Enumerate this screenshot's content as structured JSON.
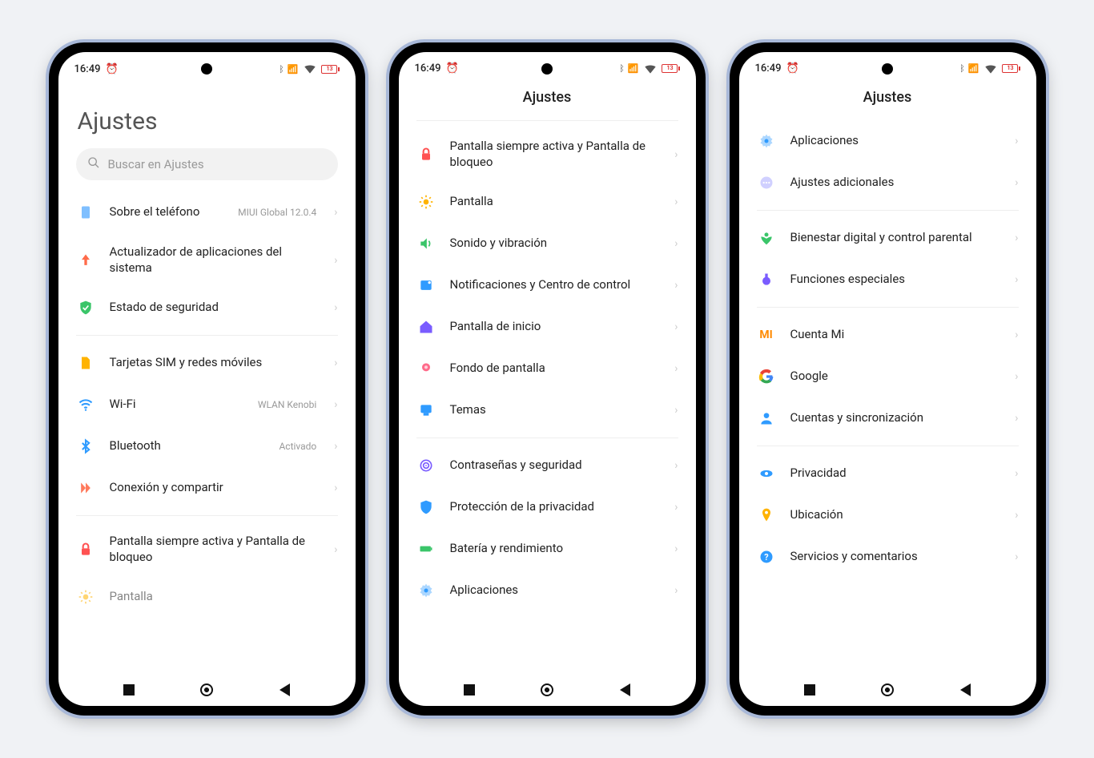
{
  "statusbar": {
    "time": "16:49",
    "battery": "13"
  },
  "search": {
    "placeholder": "Buscar en Ajustes"
  },
  "phone1": {
    "title": "Ajustes",
    "items": [
      {
        "label": "Sobre el teléfono",
        "sub": "MIUI Global 12.0.4"
      },
      {
        "label": "Actualizador de aplicaciones del sistema"
      },
      {
        "label": "Estado de seguridad"
      },
      {
        "label": "Tarjetas SIM y redes móviles"
      },
      {
        "label": "Wi-Fi",
        "sub": "WLAN Kenobi"
      },
      {
        "label": "Bluetooth",
        "sub": "Activado"
      },
      {
        "label": "Conexión y compartir"
      },
      {
        "label": "Pantalla siempre activa y Pantalla de bloqueo"
      },
      {
        "label": "Pantalla"
      }
    ]
  },
  "phone2": {
    "title": "Ajustes",
    "items": [
      {
        "label": "Pantalla siempre activa y Pantalla de bloqueo"
      },
      {
        "label": "Pantalla"
      },
      {
        "label": "Sonido y vibración"
      },
      {
        "label": "Notificaciones y Centro de control"
      },
      {
        "label": "Pantalla de inicio"
      },
      {
        "label": "Fondo de pantalla"
      },
      {
        "label": "Temas"
      },
      {
        "label": "Contraseñas y seguridad"
      },
      {
        "label": "Protección de la privacidad"
      },
      {
        "label": "Batería y rendimiento"
      },
      {
        "label": "Aplicaciones"
      }
    ]
  },
  "phone3": {
    "title": "Ajustes",
    "items": [
      {
        "label": "Aplicaciones"
      },
      {
        "label": "Ajustes adicionales"
      },
      {
        "label": "Bienestar digital y control parental"
      },
      {
        "label": "Funciones especiales"
      },
      {
        "label": "Cuenta Mi"
      },
      {
        "label": "Google"
      },
      {
        "label": "Cuentas y sincronización"
      },
      {
        "label": "Privacidad"
      },
      {
        "label": "Ubicación"
      },
      {
        "label": "Servicios y comentarios"
      }
    ]
  }
}
